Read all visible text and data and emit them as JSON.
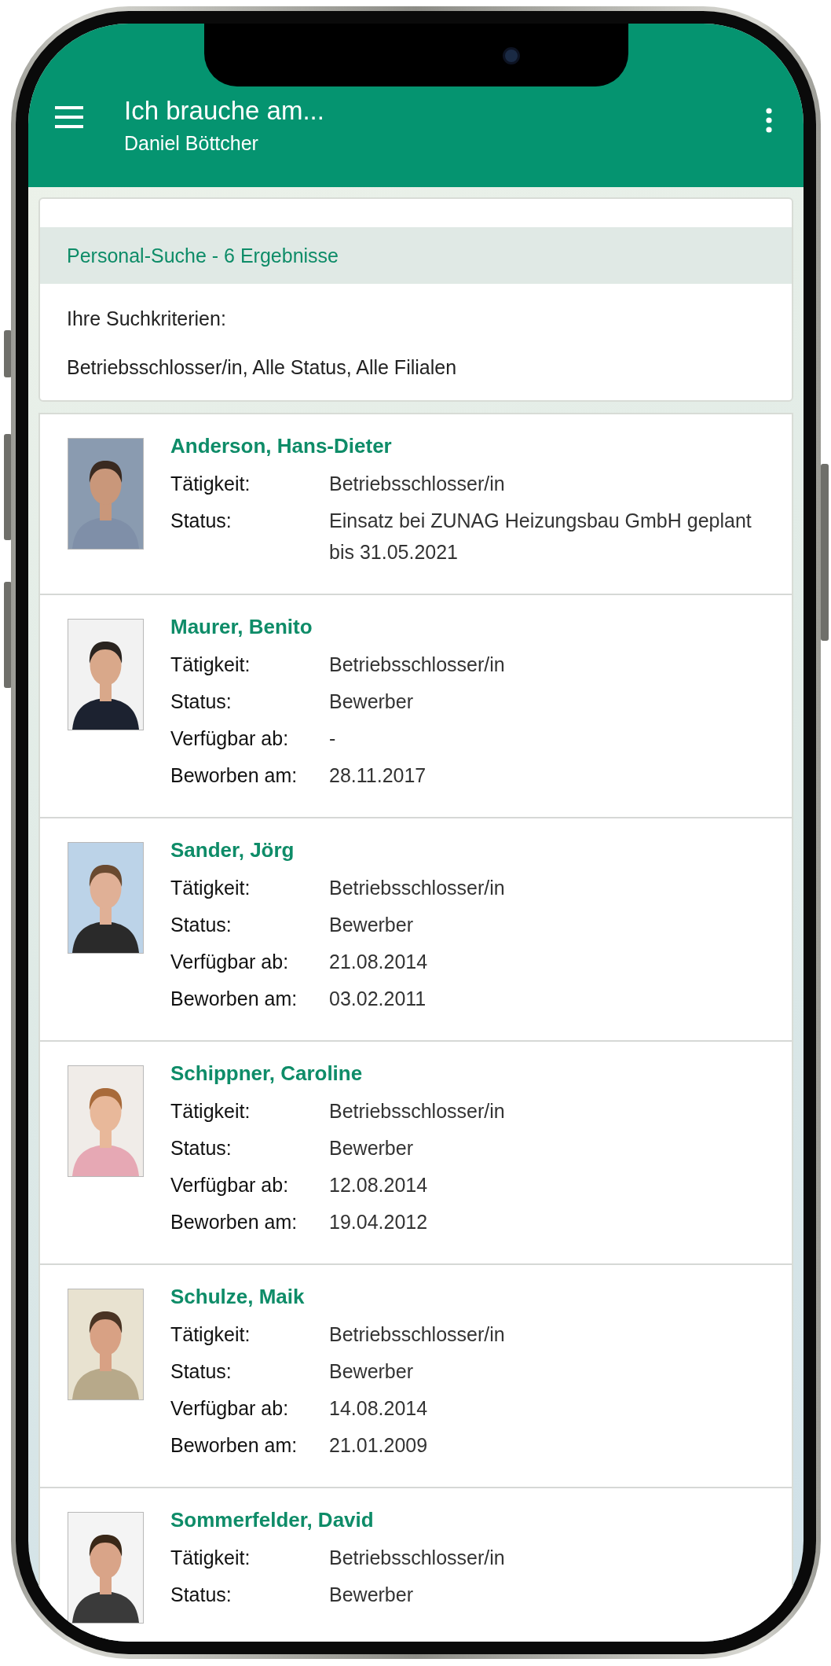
{
  "app_bar": {
    "title": "Ich brauche am...",
    "subtitle": "Daniel Böttcher"
  },
  "search_summary": {
    "heading": "Personal-Suche - 6 Ergebnisse",
    "criteria_label": "Ihre Suchkriterien:",
    "criteria": "Betriebsschlosser/in, Alle Status, Alle Filialen"
  },
  "results": [
    {
      "name": "Anderson, Hans-Dieter",
      "fields": [
        {
          "label": "Tätigkeit:",
          "value": "Betriebsschlosser/in"
        },
        {
          "label": "Status:",
          "value": "Einsatz bei ZUNAG Heizungsbau GmbH geplant bis 31.05.2021"
        }
      ]
    },
    {
      "name": "Maurer, Benito",
      "fields": [
        {
          "label": "Tätigkeit:",
          "value": "Betriebsschlosser/in"
        },
        {
          "label": "Status:",
          "value": "Bewerber"
        },
        {
          "label": "Verfügbar ab:",
          "value": "-"
        },
        {
          "label": "Beworben am:",
          "value": "28.11.2017"
        }
      ]
    },
    {
      "name": "Sander, Jörg",
      "fields": [
        {
          "label": "Tätigkeit:",
          "value": "Betriebsschlosser/in"
        },
        {
          "label": "Status:",
          "value": "Bewerber"
        },
        {
          "label": "Verfügbar ab:",
          "value": "21.08.2014"
        },
        {
          "label": "Beworben am:",
          "value": "03.02.2011"
        }
      ]
    },
    {
      "name": "Schippner, Caroline",
      "fields": [
        {
          "label": "Tätigkeit:",
          "value": "Betriebsschlosser/in"
        },
        {
          "label": "Status:",
          "value": "Bewerber"
        },
        {
          "label": "Verfügbar ab:",
          "value": "12.08.2014"
        },
        {
          "label": "Beworben am:",
          "value": "19.04.2012"
        }
      ]
    },
    {
      "name": "Schulze, Maik",
      "fields": [
        {
          "label": "Tätigkeit:",
          "value": "Betriebsschlosser/in"
        },
        {
          "label": "Status:",
          "value": "Bewerber"
        },
        {
          "label": "Verfügbar ab:",
          "value": "14.08.2014"
        },
        {
          "label": "Beworben am:",
          "value": "21.01.2009"
        }
      ]
    },
    {
      "name": "Sommerfelder, David",
      "fields": [
        {
          "label": "Tätigkeit:",
          "value": "Betriebsschlosser/in"
        },
        {
          "label": "Status:",
          "value": "Bewerber"
        }
      ]
    }
  ]
}
